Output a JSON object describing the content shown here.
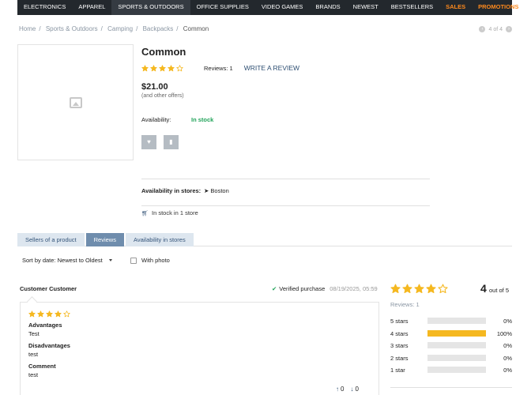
{
  "topnav": {
    "items": [
      {
        "label": "ELECTRONICS"
      },
      {
        "label": "APPAREL"
      },
      {
        "label": "SPORTS & OUTDOORS"
      },
      {
        "label": "OFFICE SUPPLIES"
      },
      {
        "label": "VIDEO GAMES"
      },
      {
        "label": "BRANDS"
      },
      {
        "label": "NEWEST"
      },
      {
        "label": "BESTSELLERS"
      },
      {
        "label": "SALES"
      },
      {
        "label": "PROMOTIONS"
      }
    ],
    "active_index": 2,
    "highlight_color": "#ff8a1d"
  },
  "breadcrumb": {
    "items": [
      "Home",
      "Sports & Outdoors",
      "Camping",
      "Backpacks"
    ],
    "current": "Common"
  },
  "pager": {
    "text": "4 of 4"
  },
  "product": {
    "title": "Common",
    "rating": 4,
    "reviews_label": "Reviews: 1",
    "write_review": "WRITE A REVIEW",
    "price": "$21.00",
    "other_offers": "(and other offers)",
    "availability_label": "Availability:",
    "availability_value": "In stock",
    "stores_label": "Availability in stores:",
    "stores_city": "Boston",
    "in_stock_prefix": "In stock in",
    "in_stock_suffix": "1 store"
  },
  "tabs": [
    {
      "label": "Sellers of a product"
    },
    {
      "label": "Reviews"
    },
    {
      "label": "Availability in stores"
    }
  ],
  "reviews": {
    "sort_label": "Sort by date: Newest to Oldest",
    "with_photo": "With photo",
    "item": {
      "author": "Customer Customer",
      "verified": "Verified purchase",
      "date": "08/19/2025, 05:59",
      "rating": 4,
      "advantages_label": "Advantages",
      "advantages": "Test",
      "disadvantages_label": "Disadvantages",
      "disadvantages": "test",
      "comment_label": "Comment",
      "comment": "test",
      "votes_up": "0",
      "votes_down": "0"
    },
    "summary": {
      "score": "4",
      "out_of": "out of 5",
      "rating": 4,
      "reviews_label": "Reviews: 1",
      "bars": [
        {
          "label": "5 stars",
          "pct": 0,
          "pct_label": "0%"
        },
        {
          "label": "4 stars",
          "pct": 100,
          "pct_label": "100%"
        },
        {
          "label": "3 stars",
          "pct": 0,
          "pct_label": "0%"
        },
        {
          "label": "2 stars",
          "pct": 0,
          "pct_label": "0%"
        },
        {
          "label": "1 star",
          "pct": 0,
          "pct_label": "0%"
        }
      ]
    }
  },
  "colors": {
    "star": "#f5b820",
    "in_stock": "#22a35a",
    "tab_active": "#6f8dad",
    "tab_inactive": "#dde6ef"
  }
}
